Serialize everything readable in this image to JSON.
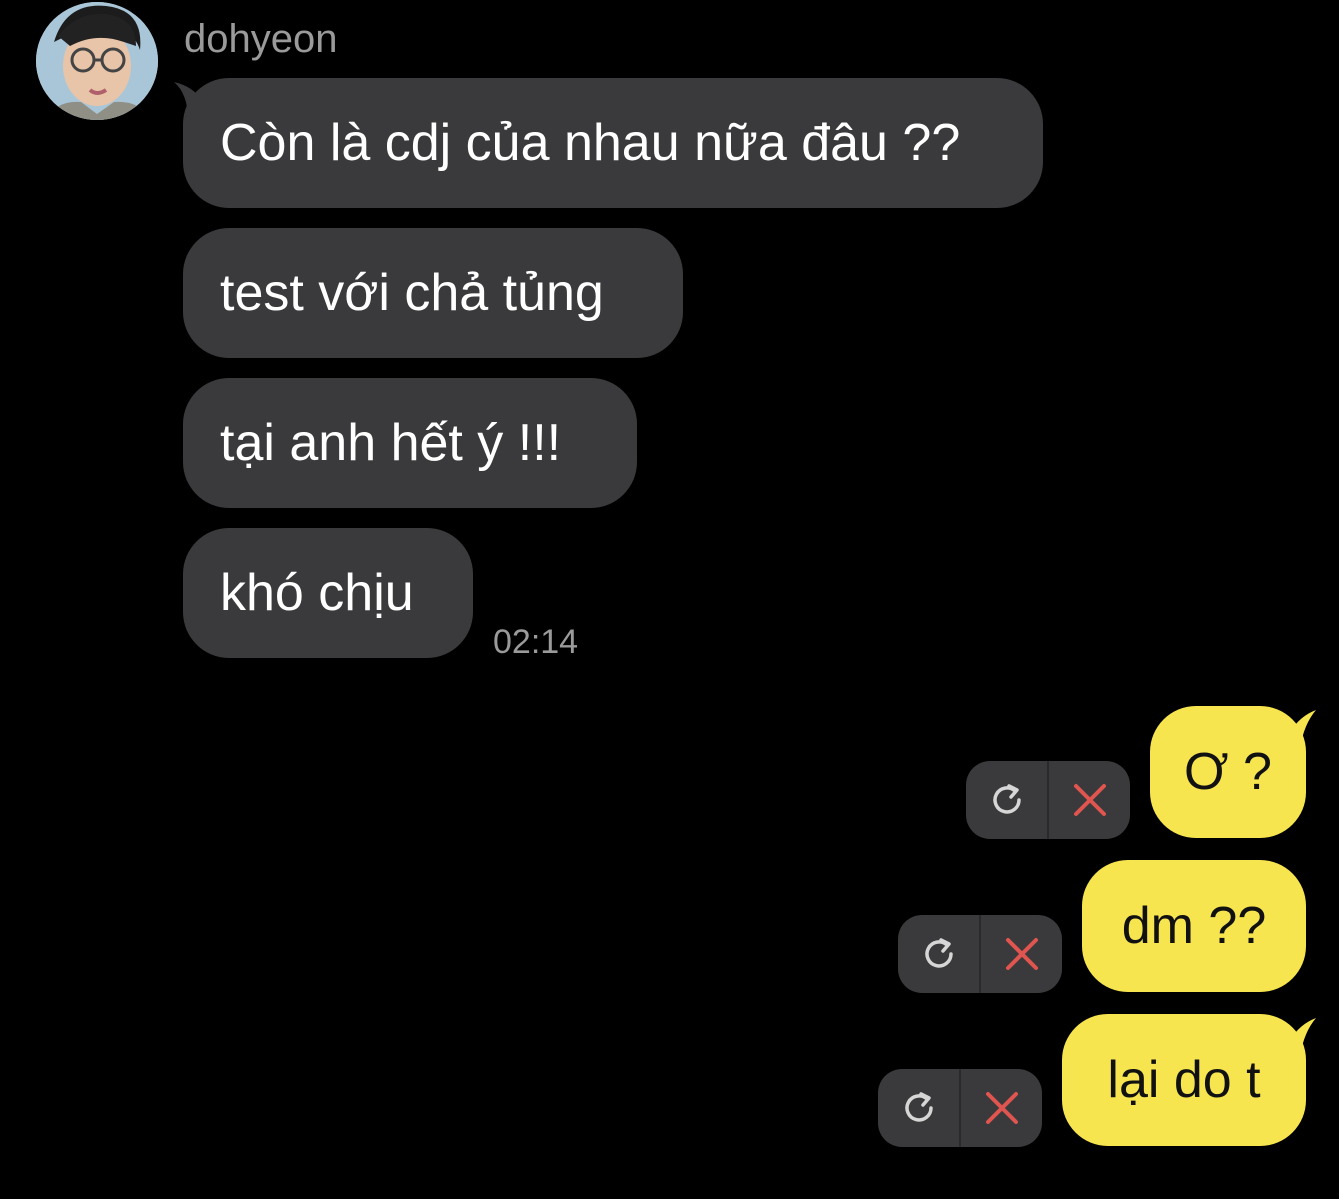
{
  "chat": {
    "sender_name": "dohyeon",
    "incoming": [
      {
        "text": "Còn là cdj của nhau nữa đâu ??"
      },
      {
        "text": "test với chả tủng"
      },
      {
        "text": "tại anh hết ý !!!"
      },
      {
        "text": "khó chịu"
      }
    ],
    "incoming_time": "02:14",
    "outgoing": [
      {
        "text": "Ơ ?"
      },
      {
        "text": "dm ??"
      },
      {
        "text": "lại do t"
      }
    ]
  },
  "colors": {
    "background": "#000000",
    "incoming_bubble": "#3a3a3c",
    "outgoing_bubble": "#f7e54f",
    "delete_icon": "#e0554f",
    "retry_icon": "#d6d6d6"
  },
  "icons": {
    "retry": "retry-icon",
    "delete": "close-icon"
  }
}
